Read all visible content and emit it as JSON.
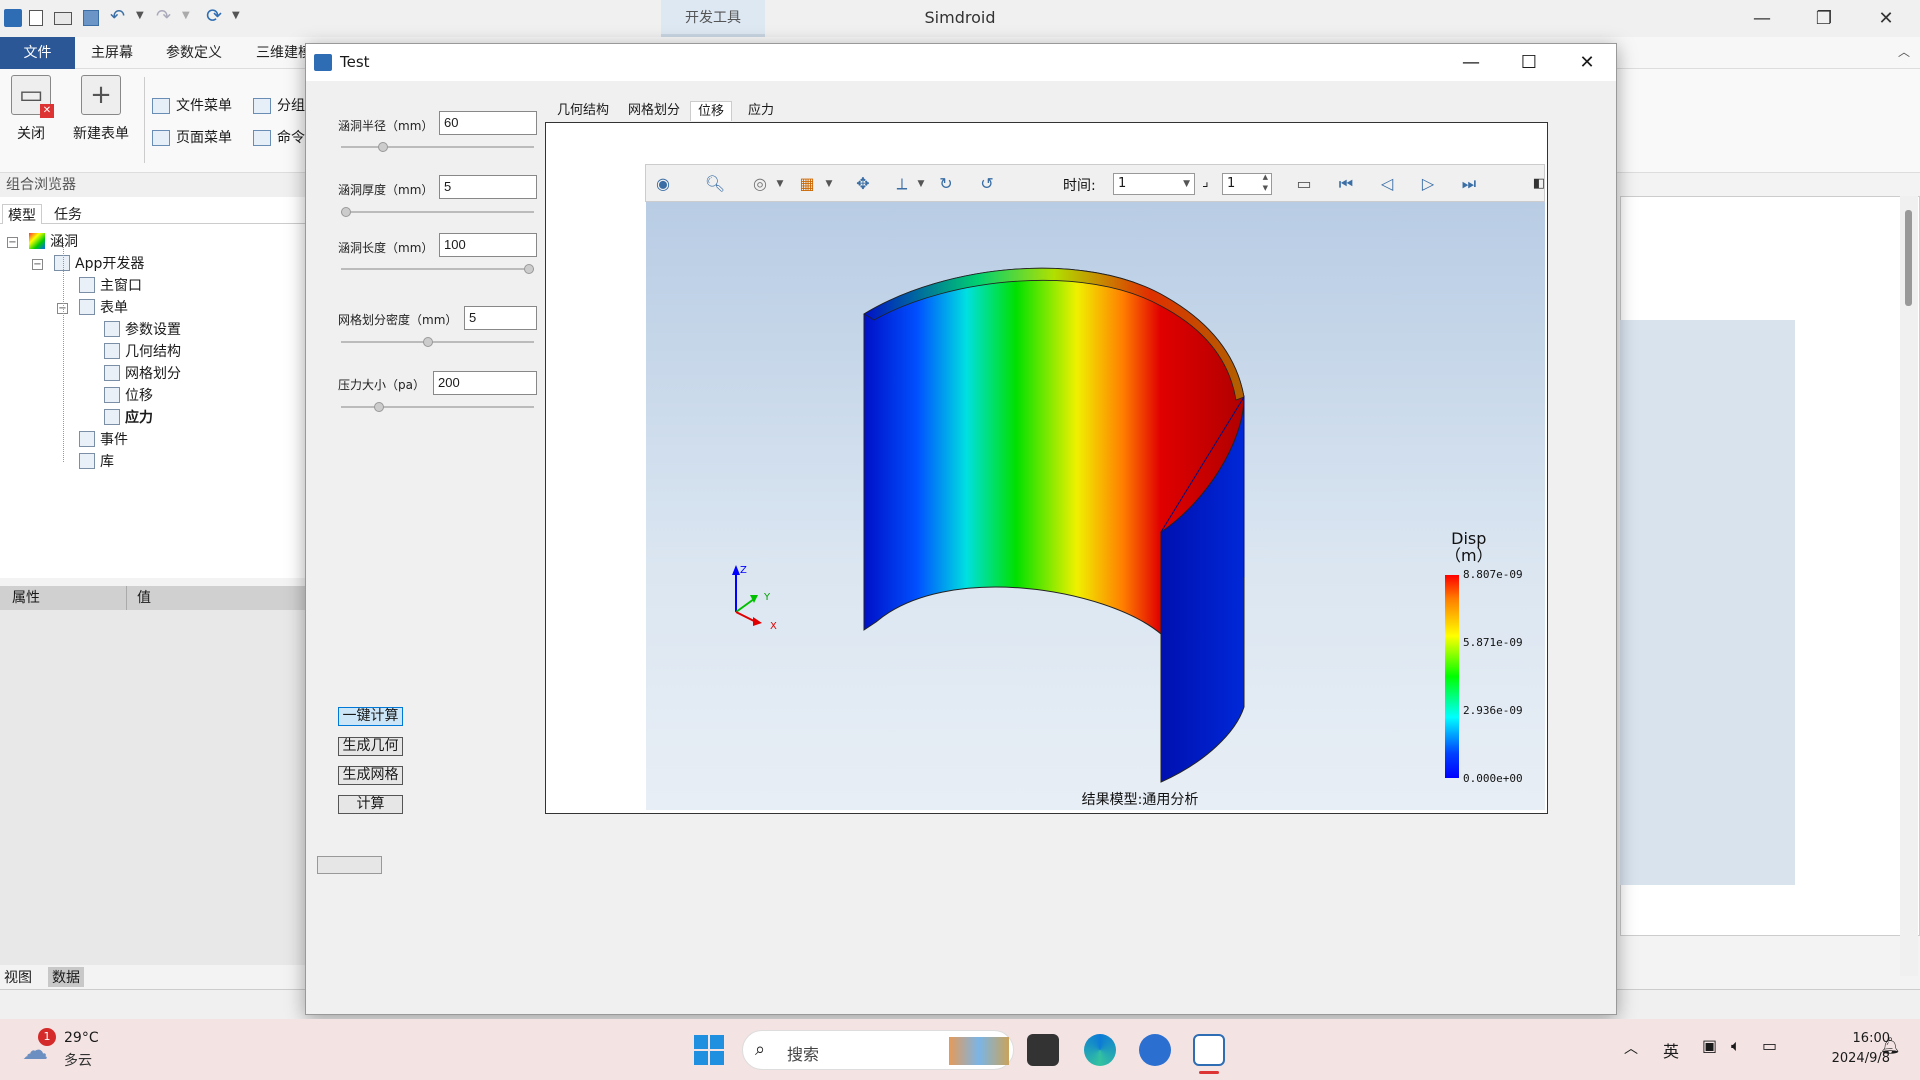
{
  "app": {
    "title": "Simdroid",
    "context_tab": "开发工具",
    "menu": [
      "文件",
      "主屏幕",
      "参数定义",
      "三维建模"
    ],
    "ribbon": {
      "close": "关闭",
      "new_form": "新建表单",
      "file_menu": "文件菜单",
      "page_menu": "页面菜单",
      "group": "分组",
      "command": "命令"
    }
  },
  "browser": {
    "title": "组合浏览器",
    "tabs": [
      "模型",
      "任务"
    ],
    "tree": {
      "root": "涵洞",
      "app_dev": "App开发器",
      "main_window": "主窗口",
      "forms": "表单",
      "form_items": [
        "参数设置",
        "几何结构",
        "网格划分",
        "位移",
        "应力"
      ],
      "events": "事件",
      "library": "库"
    }
  },
  "properties": {
    "col_prop": "属性",
    "col_value": "值"
  },
  "bottom_tabs": [
    "视图",
    "数据"
  ],
  "dialog": {
    "title": "Test",
    "params": [
      {
        "label": "涵洞半径（mm）",
        "value": "60",
        "level": 0.2
      },
      {
        "label": "涵洞厚度（mm）",
        "value": "5",
        "level": 0.0
      },
      {
        "label": "涵洞长度（mm）",
        "value": "100",
        "level": 1.0
      },
      {
        "label": "网格划分密度（mm）",
        "value": "5",
        "level": 0.45
      },
      {
        "label": "压力大小（pa）",
        "value": "200",
        "level": 0.18
      }
    ],
    "buttons": {
      "one_click": "一键计算",
      "gen_geometry": "生成几何",
      "gen_mesh": "生成网格",
      "compute": "计算"
    },
    "tabs": [
      "几何结构",
      "网格划分",
      "位移",
      "应力"
    ],
    "active_tab": "位移",
    "viewer": {
      "time_label": "时间:",
      "time_value": "1",
      "step_value": "1",
      "caption": "结果模型:通用分析",
      "legend": {
        "title_line1": "Disp",
        "title_line2": "（m）",
        "values": [
          "8.807e-09",
          "5.871e-09",
          "2.936e-09",
          "0.000e+00"
        ]
      },
      "axes": {
        "z": "Z",
        "y": "Y",
        "x": "X"
      }
    }
  },
  "taskbar": {
    "weather_temp": "29°C",
    "weather_desc": "多云",
    "weather_badge": "1",
    "search_placeholder": "搜索",
    "ime": "英",
    "time": "16:00",
    "date": "2024/9/8"
  }
}
